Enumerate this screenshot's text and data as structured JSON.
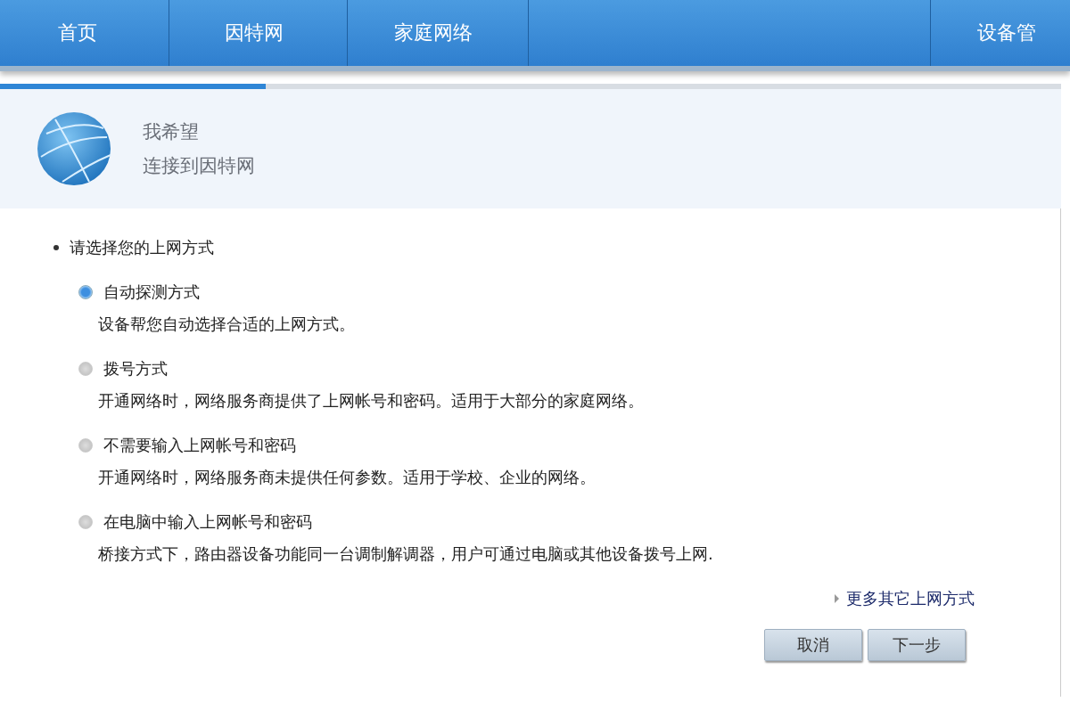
{
  "nav": [
    {
      "label": "首页"
    },
    {
      "label": "因特网"
    },
    {
      "label": "家庭网络"
    },
    {
      "label": "设备管"
    }
  ],
  "progress": {
    "level": 0.25
  },
  "header": {
    "title": "我希望",
    "subtitle": "连接到因特网"
  },
  "question": "请选择您的上网方式",
  "options": [
    {
      "label": "自动探测方式",
      "description": "设备帮您自动选择合适的上网方式。",
      "selected": true
    },
    {
      "label": "拨号方式",
      "description": "开通网络时，网络服务商提供了上网帐号和密码。适用于大部分的家庭网络。",
      "selected": false
    },
    {
      "label": "不需要输入上网帐号和密码",
      "description": "开通网络时，网络服务商未提供任何参数。适用于学校、企业的网络。",
      "selected": false
    },
    {
      "label": "在电脑中输入上网帐号和密码",
      "description": "桥接方式下，路由器设备功能同一台调制解调器，用户可通过电脑或其他设备拨号上网.",
      "selected": false
    }
  ],
  "more_link": "更多其它上网方式",
  "buttons": [
    "取消",
    "下一步"
  ]
}
